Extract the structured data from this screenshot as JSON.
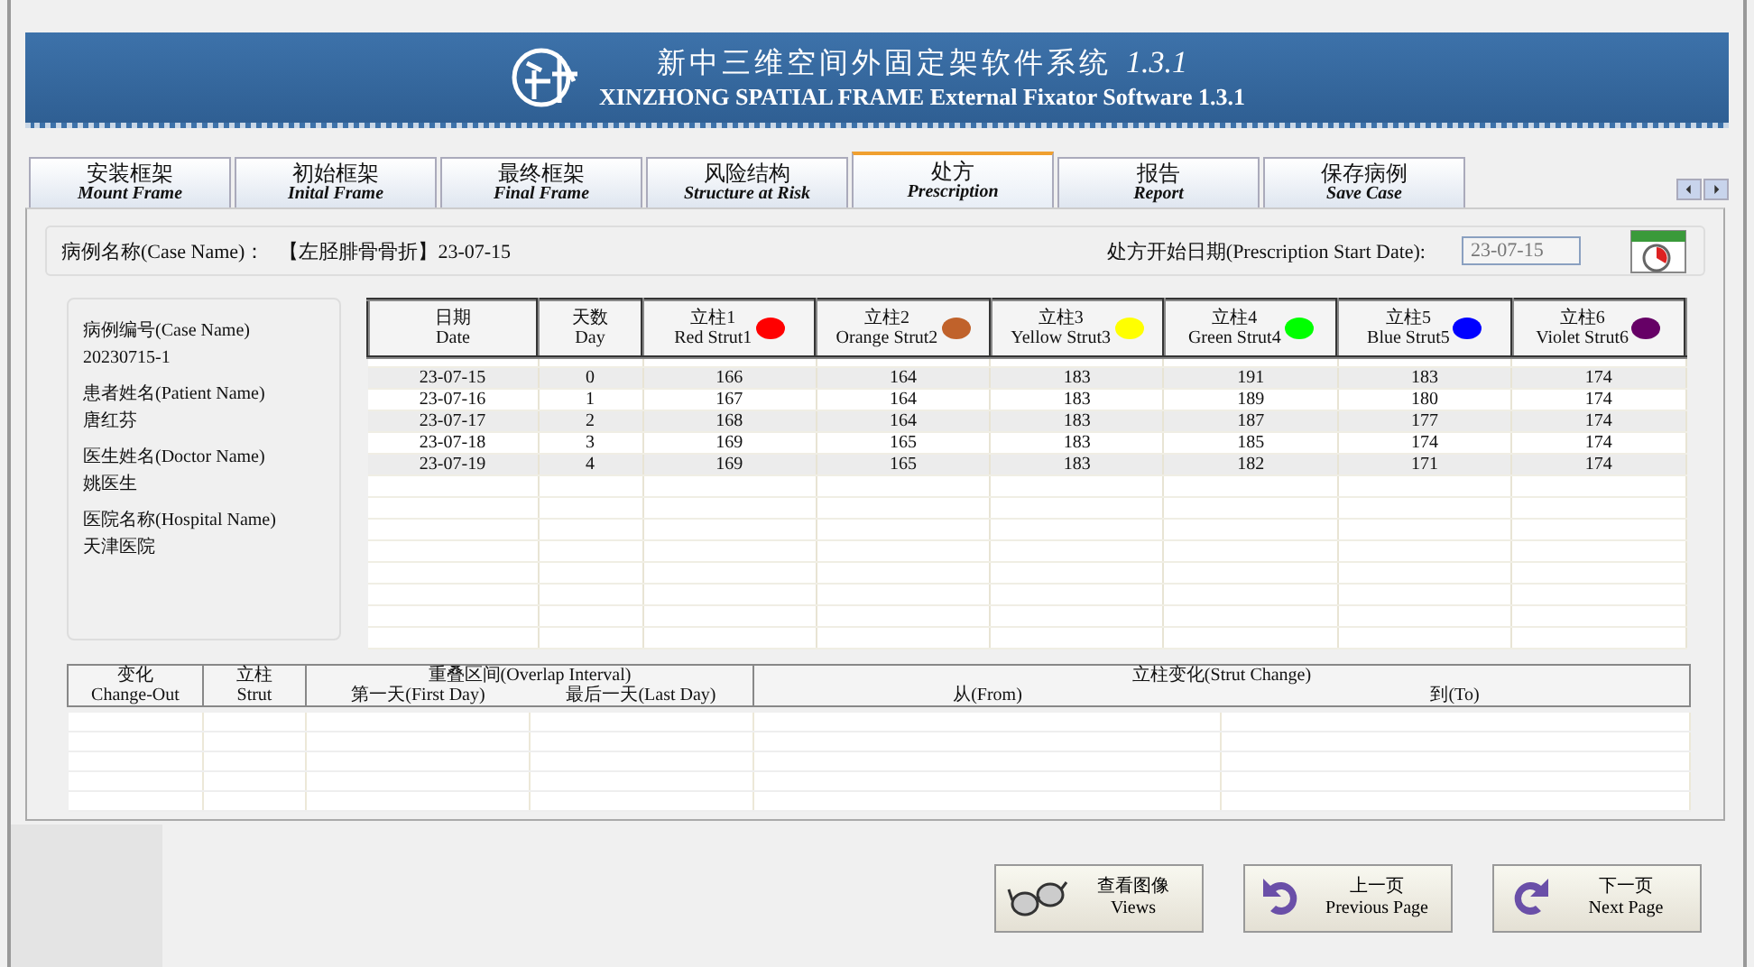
{
  "header": {
    "title_cn": "新中三维空间外固定架软件系统",
    "version": "1.3.1",
    "title_en": "XINZHONG SPATIAL FRAME External Fixator Software 1.3.1"
  },
  "tabs": [
    {
      "label_cn": "安装框架",
      "label_en": "Mount Frame",
      "selected": false
    },
    {
      "label_cn": "初始框架",
      "label_en": "Inital Frame",
      "selected": false
    },
    {
      "label_cn": "最终框架",
      "label_en": "Final Frame",
      "selected": false
    },
    {
      "label_cn": "风险结构",
      "label_en": "Structure at Risk",
      "selected": false
    },
    {
      "label_cn": "处方",
      "label_en": "Prescription",
      "selected": true
    },
    {
      "label_cn": "报告",
      "label_en": "Report",
      "selected": false
    },
    {
      "label_cn": "保存病例",
      "label_en": "Save Case",
      "selected": false
    }
  ],
  "case_bar": {
    "case_label": "病例名称(Case Name)：",
    "case_value": "【左胫腓骨骨折】23-07-15",
    "start_label": "处方开始日期(Prescription Start Date):",
    "start_date": "23-07-15"
  },
  "patient_info": [
    {
      "label": "病例编号(Case Name)",
      "value": "20230715-1"
    },
    {
      "label": "患者姓名(Patient Name)",
      "value": "唐红芬"
    },
    {
      "label": "医生姓名(Doctor Name)",
      "value": "姚医生"
    },
    {
      "label": "医院名称(Hospital Name)",
      "value": "天津医院"
    }
  ],
  "prescription_table": {
    "columns": [
      {
        "cn": "日期",
        "en": "Date"
      },
      {
        "cn": "天数",
        "en": "Day"
      },
      {
        "cn": "立柱1",
        "en": "Red Strut1",
        "color": "#ff0000"
      },
      {
        "cn": "立柱2",
        "en": "Orange Strut2",
        "color": "#c0622b"
      },
      {
        "cn": "立柱3",
        "en": "Yellow Strut3",
        "color": "#ffff00"
      },
      {
        "cn": "立柱4",
        "en": "Green Strut4",
        "color": "#00ff00"
      },
      {
        "cn": "立柱5",
        "en": "Blue Strut5",
        "color": "#0000ff"
      },
      {
        "cn": "立柱6",
        "en": "Violet Strut6",
        "color": "#660066"
      }
    ],
    "rows": [
      [
        "23-07-15",
        "0",
        "166",
        "164",
        "183",
        "191",
        "183",
        "174"
      ],
      [
        "23-07-16",
        "1",
        "167",
        "164",
        "183",
        "189",
        "180",
        "174"
      ],
      [
        "23-07-17",
        "2",
        "168",
        "164",
        "183",
        "187",
        "177",
        "174"
      ],
      [
        "23-07-18",
        "3",
        "169",
        "165",
        "183",
        "185",
        "174",
        "174"
      ],
      [
        "23-07-19",
        "4",
        "169",
        "165",
        "183",
        "182",
        "171",
        "174"
      ]
    ]
  },
  "change_table": {
    "change_out": {
      "cn": "变化",
      "en": "Change-Out"
    },
    "strut": {
      "cn": "立柱",
      "en": "Strut"
    },
    "overlap": "重叠区间(Overlap Interval)",
    "first_day": "第一天(First Day)",
    "last_day": "最后一天(Last Day)",
    "strut_change": "立柱变化(Strut Change)",
    "from": "从(From)",
    "to": "到(To)"
  },
  "buttons": [
    {
      "kind": "views",
      "cn": "查看图像",
      "en": "Views"
    },
    {
      "kind": "previous",
      "cn": "上一页",
      "en": "Previous Page"
    },
    {
      "kind": "next",
      "cn": "下一页",
      "en": "Next Page"
    }
  ]
}
